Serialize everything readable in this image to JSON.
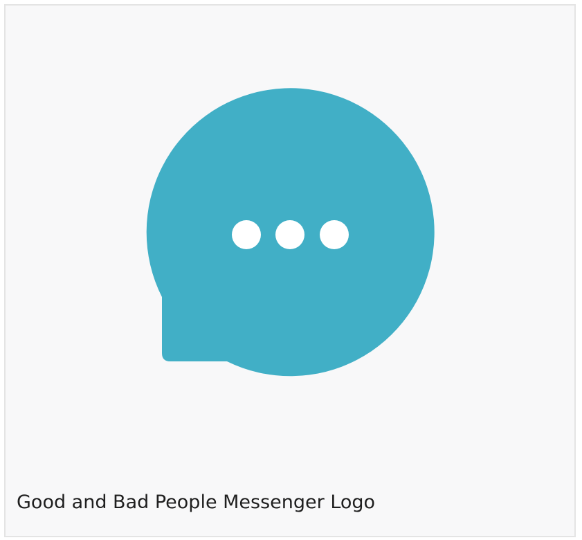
{
  "card": {
    "caption": "Good and Bad People Messenger Logo"
  },
  "logo": {
    "icon": "chat-bubble-ellipsis-icon",
    "bubble_color": "#41afc6",
    "dot_color": "#ffffff",
    "background_color": "#f8f8f9"
  }
}
